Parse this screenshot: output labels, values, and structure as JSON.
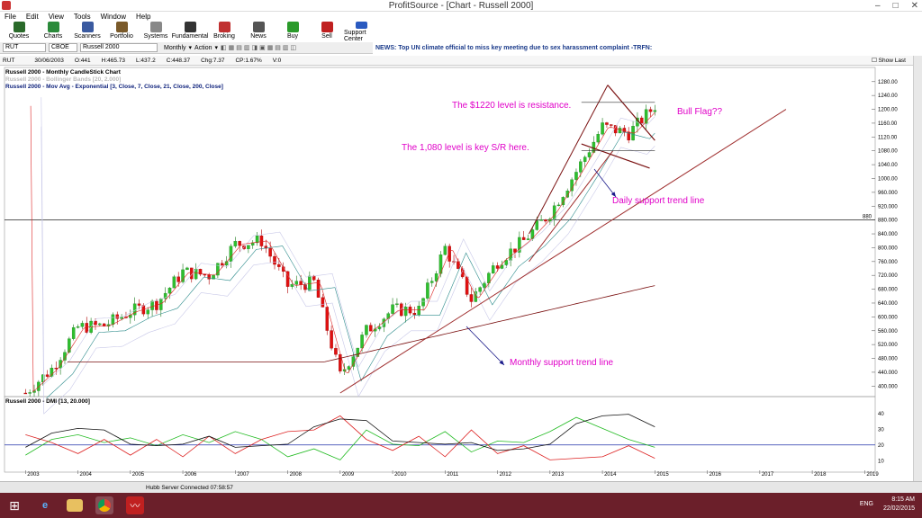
{
  "window": {
    "title": "ProfitSource - [Chart - Russell 2000]"
  },
  "menu": [
    "File",
    "Edit",
    "View",
    "Tools",
    "Window",
    "Help"
  ],
  "toolbar": [
    {
      "label": "Quotes",
      "icon": "quotes-icon",
      "color": "#2a6a2a"
    },
    {
      "label": "Charts",
      "icon": "charts-icon",
      "color": "#2a8a3a"
    },
    {
      "label": "Scanners",
      "icon": "scanners-icon",
      "color": "#3a5aa0"
    },
    {
      "label": "Portfolio",
      "icon": "portfolio-icon",
      "color": "#7a5a2a"
    },
    {
      "label": "Systems",
      "icon": "systems-icon",
      "color": "#888888"
    },
    {
      "label": "Fundamental",
      "icon": "fundamental-icon",
      "color": "#333333"
    },
    {
      "label": "Broking",
      "icon": "broking-icon",
      "color": "#c03030"
    },
    {
      "label": "News",
      "icon": "news-icon",
      "color": "#555555"
    },
    {
      "label": "Buy",
      "icon": "buy-icon",
      "color": "#2a9a2a"
    },
    {
      "label": "Sell",
      "icon": "sell-icon",
      "color": "#c02020"
    },
    {
      "label": "Support Center",
      "icon": "support-icon",
      "color": "#2a5ac0"
    }
  ],
  "symbol_bar": {
    "symbol": "RUT",
    "exchange": "CBOE",
    "name": "Russell 2000",
    "period": "Monthly",
    "action": "Action",
    "news": "NEWS: Top UN climate official to miss key meeting due to sex harassment complaint -TRFN:"
  },
  "quote": {
    "symbol": "RUT",
    "date": "30/06/2003",
    "open": "O:441",
    "high": "H:465.73",
    "low": "L:437.2",
    "close": "C:448.37",
    "chg": "Chg:7.37",
    "cp": "CP:1.67%",
    "volume": "V:0",
    "show_last": "Show Last"
  },
  "legend": {
    "line1": "Russell 2000 - Monthly CandleStick Chart",
    "line2": "Russell 2000 - Bollinger Bands [20, 2.000]",
    "line3": "Russell 2000 - Mov Avg - Exponential [3, Close, 7, Close, 21, Close, 200, Close]",
    "dmi": "Russell 2000 - DMI [13, 20.000]"
  },
  "annotations": {
    "resistance": "The $1220 level is resistance.",
    "bull_flag": "Bull Flag??",
    "key_sr": "The 1,080 level is key S/R here.",
    "daily_trend": "Daily support trend line",
    "monthly_trend": "Monthly support trend line",
    "level_880": "880"
  },
  "chart_data": {
    "type": "candlestick",
    "title": "Russell 2000 - Monthly CandleStick Chart",
    "x_ticks": [
      "2003",
      "2004",
      "2005",
      "2006",
      "2007",
      "2008",
      "2009",
      "2010",
      "2011",
      "2012",
      "2013",
      "2014",
      "2015",
      "2016",
      "2017",
      "2018",
      "2019"
    ],
    "y_ticks": [
      "1280.00",
      "1240.00",
      "1200.00",
      "1160.00",
      "1120.00",
      "1080.00",
      "1040.00",
      "1000.00",
      "960.000",
      "920.000",
      "880.000",
      "840.000",
      "800.000",
      "760.000",
      "720.000",
      "680.000",
      "640.000",
      "600.000",
      "560.000",
      "520.000",
      "480.000",
      "440.000",
      "400.000"
    ],
    "ylim": [
      380,
      1295
    ],
    "dmi_ticks": [
      "40",
      "30",
      "20",
      "10"
    ],
    "dmi_ylim": [
      5,
      45
    ],
    "horizontal_line": 880,
    "closes": [
      {
        "x": 2003.0,
        "y": 380
      },
      {
        "x": 2003.5,
        "y": 450
      },
      {
        "x": 2004.0,
        "y": 570
      },
      {
        "x": 2004.5,
        "y": 575
      },
      {
        "x": 2005.0,
        "y": 615
      },
      {
        "x": 2005.5,
        "y": 640
      },
      {
        "x": 2006.0,
        "y": 730
      },
      {
        "x": 2006.5,
        "y": 720
      },
      {
        "x": 2007.0,
        "y": 810
      },
      {
        "x": 2007.5,
        "y": 820
      },
      {
        "x": 2008.0,
        "y": 690
      },
      {
        "x": 2008.5,
        "y": 700
      },
      {
        "x": 2009.0,
        "y": 430
      },
      {
        "x": 2009.5,
        "y": 560
      },
      {
        "x": 2010.0,
        "y": 620
      },
      {
        "x": 2010.5,
        "y": 620
      },
      {
        "x": 2011.0,
        "y": 800
      },
      {
        "x": 2011.5,
        "y": 650
      },
      {
        "x": 2012.0,
        "y": 760
      },
      {
        "x": 2012.5,
        "y": 820
      },
      {
        "x": 2013.0,
        "y": 900
      },
      {
        "x": 2013.5,
        "y": 1020
      },
      {
        "x": 2014.0,
        "y": 1150
      },
      {
        "x": 2014.5,
        "y": 1130
      },
      {
        "x": 2015.0,
        "y": 1210
      }
    ],
    "dmi_series": [
      {
        "name": "+DI",
        "color": "#22bb22",
        "values": [
          [
            2003.0,
            15
          ],
          [
            2003.5,
            22
          ],
          [
            2004.0,
            28
          ],
          [
            2004.5,
            20
          ],
          [
            2005.0,
            26
          ],
          [
            2005.5,
            18
          ],
          [
            2006.0,
            28
          ],
          [
            2006.5,
            20
          ],
          [
            2007.0,
            30
          ],
          [
            2007.5,
            22
          ],
          [
            2008.0,
            14
          ],
          [
            2008.5,
            16
          ],
          [
            2009.0,
            12
          ],
          [
            2009.5,
            28
          ],
          [
            2010.0,
            22
          ],
          [
            2010.5,
            18
          ],
          [
            2011.0,
            30
          ],
          [
            2011.5,
            14
          ],
          [
            2012.0,
            24
          ],
          [
            2012.5,
            20
          ],
          [
            2013.0,
            30
          ],
          [
            2013.5,
            36
          ],
          [
            2014.0,
            32
          ],
          [
            2014.5,
            22
          ],
          [
            2015.0,
            20
          ]
        ]
      },
      {
        "name": "-DI",
        "color": "#dd2222",
        "values": [
          [
            2003.0,
            28
          ],
          [
            2003.5,
            20
          ],
          [
            2004.0,
            16
          ],
          [
            2004.5,
            22
          ],
          [
            2005.0,
            15
          ],
          [
            2005.5,
            22
          ],
          [
            2006.0,
            14
          ],
          [
            2006.5,
            24
          ],
          [
            2007.0,
            16
          ],
          [
            2007.5,
            22
          ],
          [
            2008.0,
            30
          ],
          [
            2008.5,
            28
          ],
          [
            2009.0,
            40
          ],
          [
            2009.5,
            22
          ],
          [
            2010.0,
            18
          ],
          [
            2010.5,
            24
          ],
          [
            2011.0,
            14
          ],
          [
            2011.5,
            28
          ],
          [
            2012.0,
            16
          ],
          [
            2012.5,
            18
          ],
          [
            2013.0,
            12
          ],
          [
            2013.5,
            10
          ],
          [
            2014.0,
            14
          ],
          [
            2014.5,
            18
          ],
          [
            2015.0,
            13
          ]
        ]
      },
      {
        "name": "ADX",
        "color": "#111111",
        "values": [
          [
            2003.0,
            20
          ],
          [
            2003.5,
            26
          ],
          [
            2004.0,
            32
          ],
          [
            2004.5,
            28
          ],
          [
            2005.0,
            22
          ],
          [
            2005.5,
            18
          ],
          [
            2006.0,
            22
          ],
          [
            2006.5,
            24
          ],
          [
            2007.0,
            20
          ],
          [
            2007.5,
            18
          ],
          [
            2008.0,
            22
          ],
          [
            2008.5,
            30
          ],
          [
            2009.0,
            38
          ],
          [
            2009.5,
            34
          ],
          [
            2010.0,
            24
          ],
          [
            2010.5,
            20
          ],
          [
            2011.0,
            22
          ],
          [
            2011.5,
            20
          ],
          [
            2012.0,
            18
          ],
          [
            2012.5,
            16
          ],
          [
            2013.0,
            22
          ],
          [
            2013.5,
            32
          ],
          [
            2014.0,
            40
          ],
          [
            2014.5,
            38
          ],
          [
            2015.0,
            33
          ]
        ]
      }
    ]
  },
  "status": {
    "text": "Hubb Server Connected 07:58:57"
  },
  "taskbar": {
    "items": [
      "windows-logo-icon",
      "internet-explorer-icon",
      "file-explorer-icon",
      "chrome-icon",
      "profitsource-icon"
    ],
    "time": "8:15 AM",
    "date": "22/02/2015",
    "lang": "ENG"
  }
}
